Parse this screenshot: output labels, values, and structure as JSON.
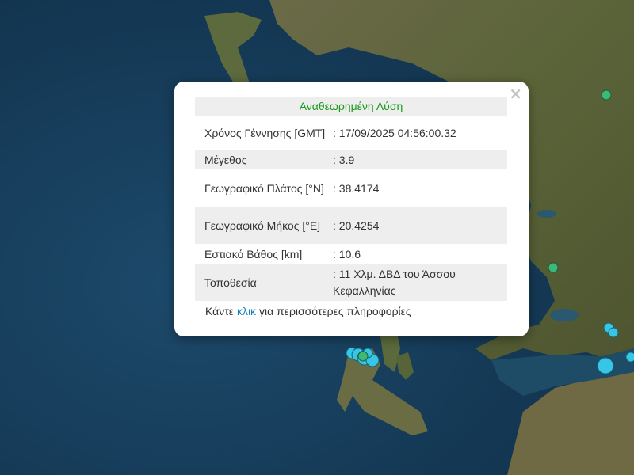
{
  "popup": {
    "title": "Αναθεωρημένη Λύση",
    "close_symbol": "×",
    "rows": [
      {
        "label": "Χρόνος Γέννησης [GMT]",
        "value": ": 17/09/2025 04:56:00.32"
      },
      {
        "label": "Μέγεθος",
        "value": ": 3.9"
      },
      {
        "label": "Γεωγραφικό Πλάτος [°N]",
        "value": ": 38.4174"
      },
      {
        "label": "Γεωγραφικό Μήκος [°E]",
        "value": ": 20.4254"
      },
      {
        "label": "Εστιακό Βάθος [km]",
        "value": ": 10.6"
      },
      {
        "label": "Τοποθεσία",
        "value": ": 11 Χλμ. ΔΒΔ του Άσσου Κεφαλληνίας"
      }
    ],
    "more_prefix": "Κάντε",
    "more_link": "κλικ",
    "more_suffix": "για περισσότερες πληροφορίες"
  },
  "colors": {
    "title_green": "#1a9b1a",
    "link_blue": "#1a7fbf",
    "marker_green": "#3cb878",
    "marker_cyan": "#37c6e6",
    "sea": "#173e5c"
  },
  "icons": {
    "close": "close-icon"
  }
}
